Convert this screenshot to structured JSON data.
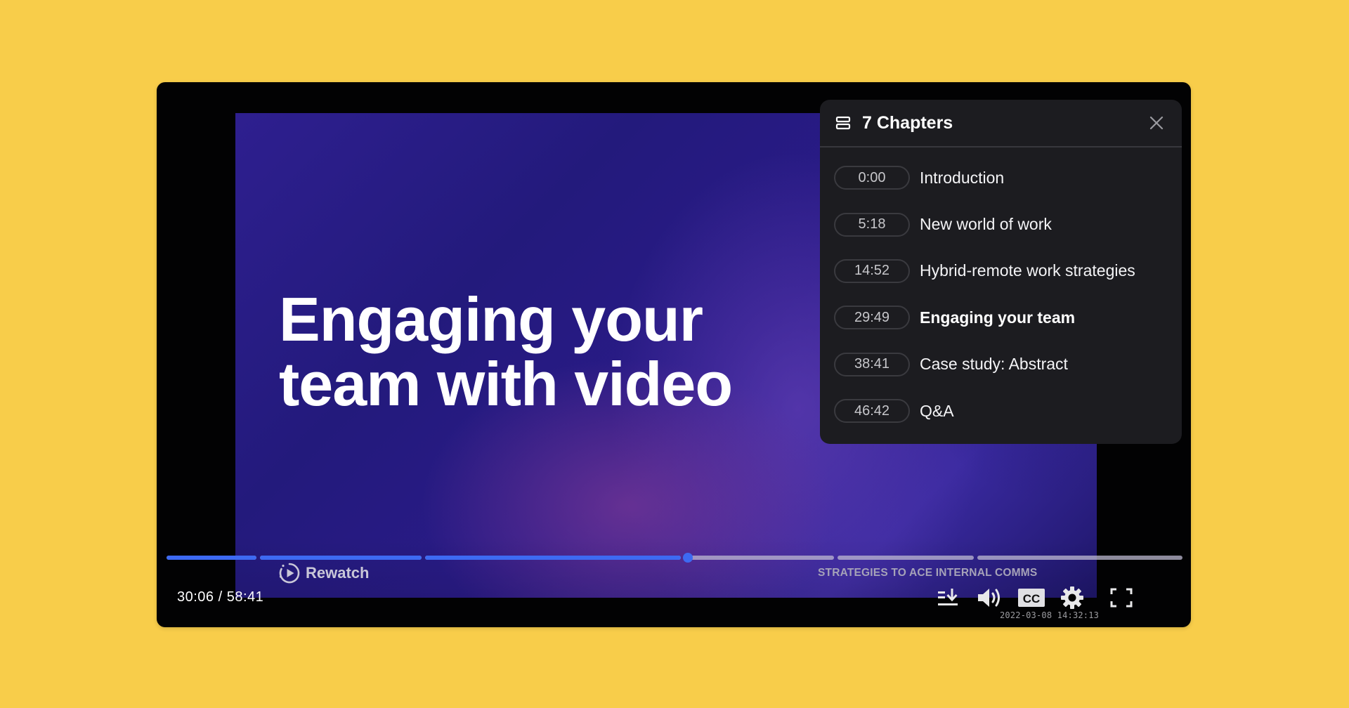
{
  "slide": {
    "title_line1": "Engaging your",
    "title_line2": "team with video"
  },
  "chapters_panel": {
    "icon": "list-icon",
    "title": "7 Chapters",
    "close_icon": "close-icon",
    "items": [
      {
        "time": "0:00",
        "label": "Introduction",
        "active": false
      },
      {
        "time": "5:18",
        "label": "New world of work",
        "active": false
      },
      {
        "time": "14:52",
        "label": "Hybrid-remote work strategies",
        "active": false
      },
      {
        "time": "29:49",
        "label": "Engaging your team",
        "active": true
      },
      {
        "time": "38:41",
        "label": "Case study: Abstract",
        "active": false
      },
      {
        "time": "46:42",
        "label": "Q&A",
        "active": false
      }
    ]
  },
  "player": {
    "current_time": "30:06",
    "duration": "58:41",
    "time_display": "30:06 / 58:41",
    "played_fraction": 0.513,
    "segments": [
      {
        "start_fraction": 0.0,
        "end_fraction": 0.09
      },
      {
        "start_fraction": 0.09,
        "end_fraction": 0.253
      },
      {
        "start_fraction": 0.253,
        "end_fraction": 0.508
      },
      {
        "start_fraction": 0.508,
        "end_fraction": 0.659
      },
      {
        "start_fraction": 0.659,
        "end_fraction": 0.796
      },
      {
        "start_fraction": 0.796,
        "end_fraction": 1.0
      }
    ],
    "rewatch_label": "Rewatch",
    "series_label": "STRATEGIES TO ACE INTERNAL COMMS",
    "timestamp": "2022-03-08  14:32:13",
    "cc_label": "CC",
    "controls": [
      "chapters-download-icon",
      "volume-icon",
      "closed-captions-icon",
      "settings-gear-icon",
      "fullscreen-icon"
    ]
  },
  "colors": {
    "background": "#f8cd4a",
    "progress_played": "#3d6af2",
    "progress_unplayed": "#bebad2",
    "panel_bg": "#1c1c20"
  }
}
